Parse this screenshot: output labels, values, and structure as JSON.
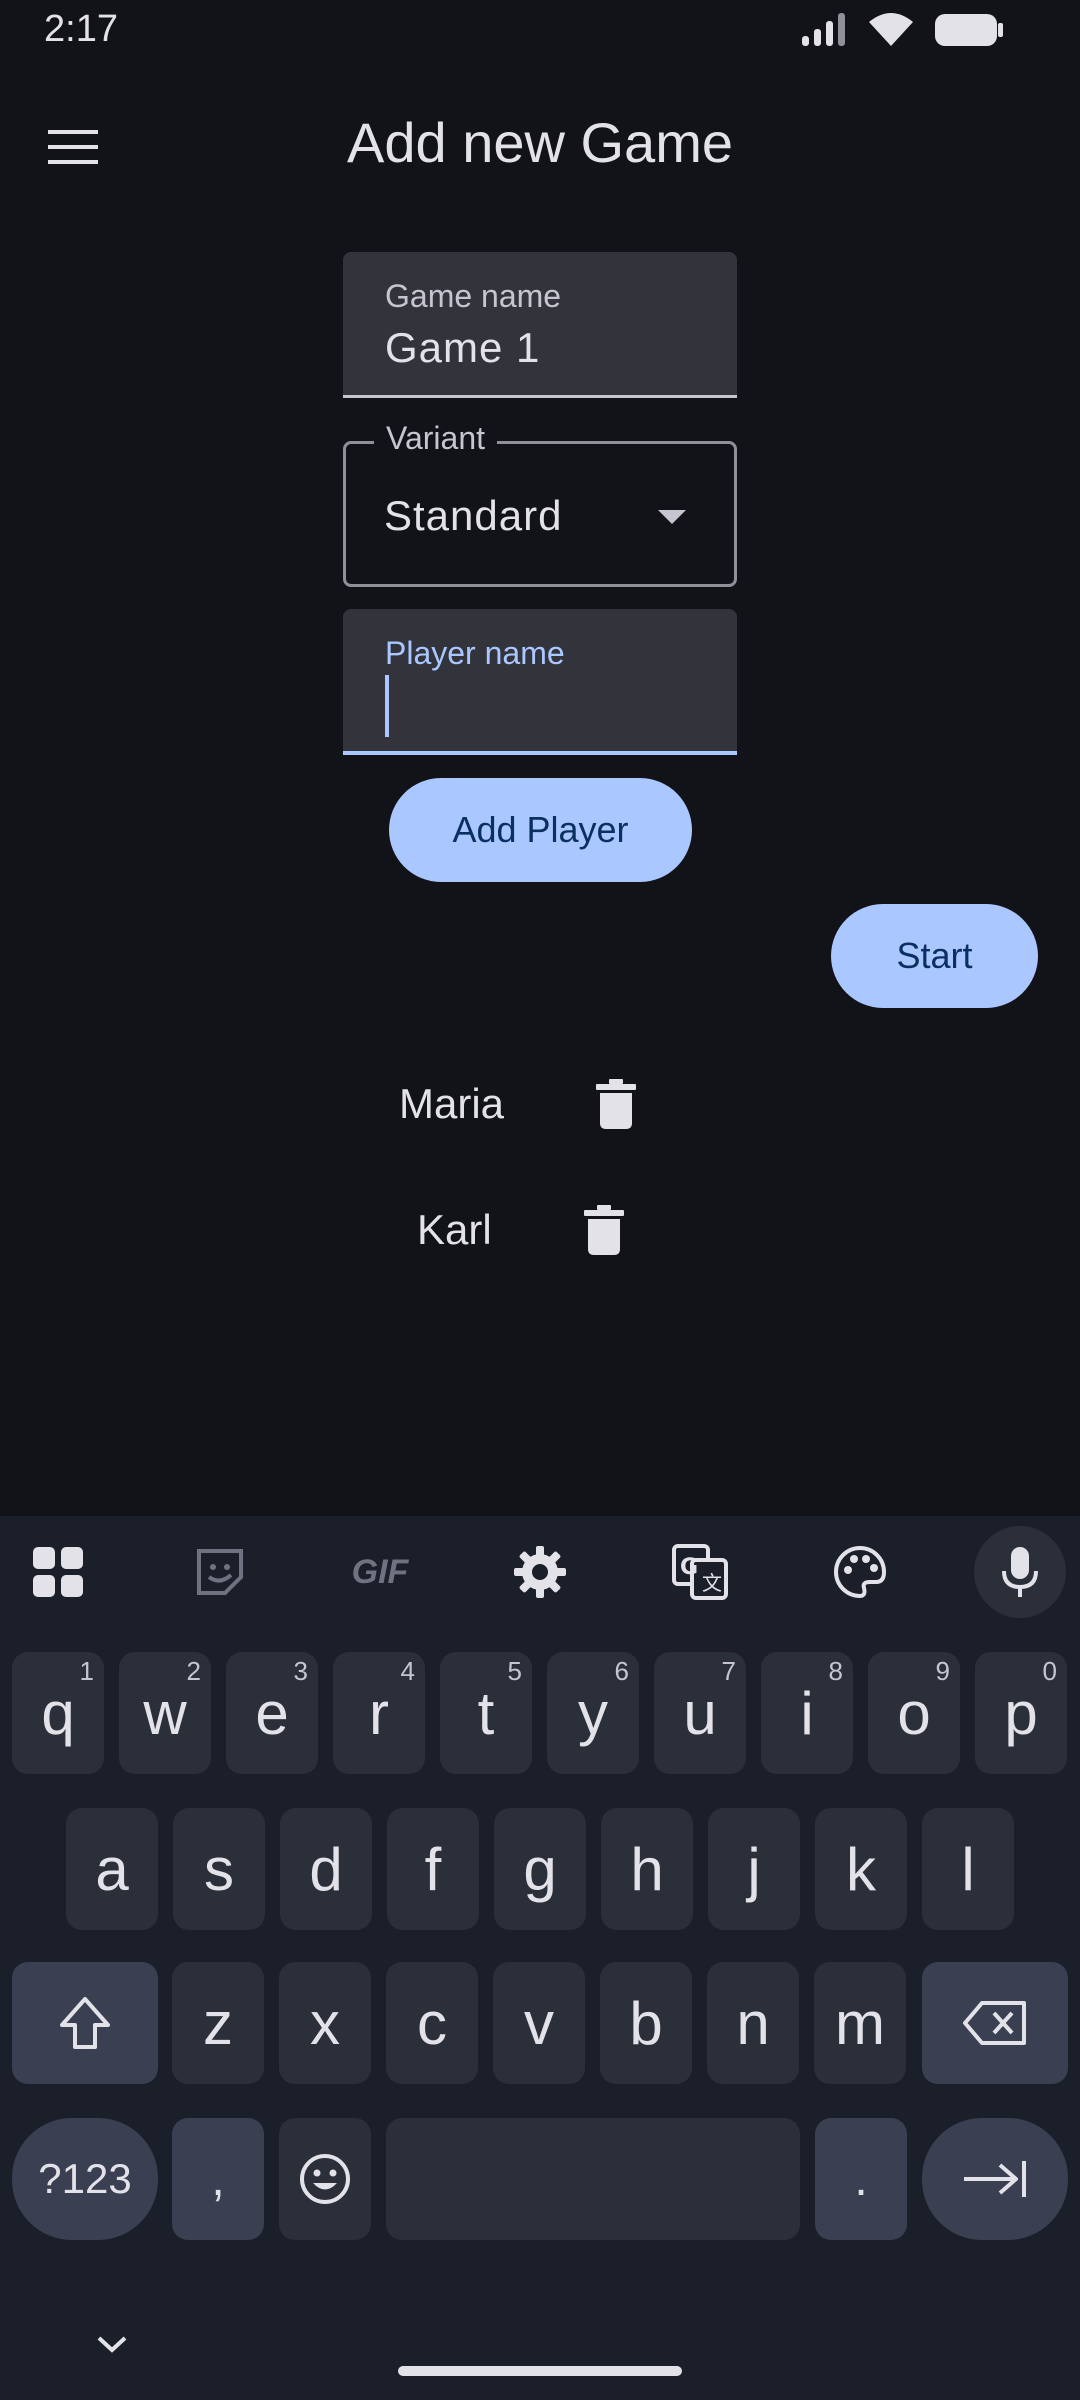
{
  "status": {
    "time": "2:17"
  },
  "app_bar": {
    "title": "Add new Game",
    "menu_icon": "menu-icon"
  },
  "form": {
    "game_name": {
      "label": "Game name",
      "value": "Game 1"
    },
    "variant": {
      "label": "Variant",
      "value": "Standard"
    },
    "player_name": {
      "label": "Player name",
      "value": ""
    },
    "add_player_label": "Add Player",
    "start_label": "Start"
  },
  "players": [
    {
      "name": "Maria"
    },
    {
      "name": "Karl"
    }
  ],
  "keyboard": {
    "toolbar": [
      "apps-icon",
      "sticker-icon",
      "gif-icon",
      "settings-icon",
      "translate-icon",
      "palette-icon",
      "mic-icon"
    ],
    "gif_label": "GIF",
    "row1": [
      {
        "k": "q",
        "h": "1"
      },
      {
        "k": "w",
        "h": "2"
      },
      {
        "k": "e",
        "h": "3"
      },
      {
        "k": "r",
        "h": "4"
      },
      {
        "k": "t",
        "h": "5"
      },
      {
        "k": "y",
        "h": "6"
      },
      {
        "k": "u",
        "h": "7"
      },
      {
        "k": "i",
        "h": "8"
      },
      {
        "k": "o",
        "h": "9"
      },
      {
        "k": "p",
        "h": "0"
      }
    ],
    "row2": [
      "a",
      "s",
      "d",
      "f",
      "g",
      "h",
      "j",
      "k",
      "l"
    ],
    "row3": [
      "z",
      "x",
      "c",
      "v",
      "b",
      "n",
      "m"
    ],
    "symbols_label": "?123",
    "comma": ",",
    "period": "."
  },
  "colors": {
    "background": "#121318",
    "accent": "#aac7ff",
    "on_accent": "#0a305f",
    "key": "#2b2f3a"
  }
}
